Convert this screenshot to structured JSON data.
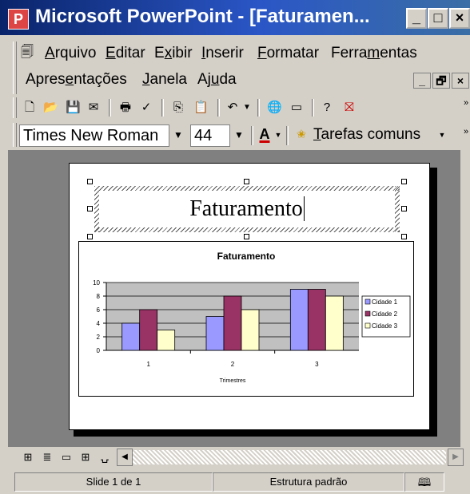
{
  "window": {
    "title": "Microsoft PowerPoint - [Faturamen...",
    "controls": [
      "_",
      "□",
      "×"
    ],
    "doc_controls": [
      "_",
      "🗗",
      "×"
    ]
  },
  "menu": {
    "items": [
      {
        "label": "Arquivo"
      },
      {
        "label": "Editar"
      },
      {
        "label": "Exibir"
      },
      {
        "label": "Inserir"
      },
      {
        "label": "Formatar"
      },
      {
        "label": "Ferramentas"
      },
      {
        "label": "Apresentações"
      },
      {
        "label": "Janela"
      },
      {
        "label": "Ajuda"
      }
    ]
  },
  "formatting": {
    "font_name": "Times New Roman",
    "font_size": "44",
    "tasks_label": "Tarefas comuns"
  },
  "slide": {
    "title": "Faturamento"
  },
  "chart_data": {
    "type": "bar",
    "title": "Faturamento",
    "xlabel": "Trimestres",
    "ylabel": "",
    "categories": [
      "1",
      "2",
      "3"
    ],
    "series": [
      {
        "name": "Cidade 1",
        "values": [
          4,
          5,
          9
        ],
        "color": "#9999ff"
      },
      {
        "name": "Cidade 2",
        "values": [
          6,
          8,
          9
        ],
        "color": "#993366"
      },
      {
        "name": "Cidade 3",
        "values": [
          3,
          6,
          8
        ],
        "color": "#ffffcc"
      }
    ],
    "ylim": [
      0,
      10
    ],
    "yticks": [
      "0",
      "2",
      "4",
      "6",
      "8",
      "10"
    ],
    "grid": true,
    "plot_background": "#c0c0c0",
    "legend": "right"
  },
  "status": {
    "slide": "Slide 1 de 1",
    "design": "Estrutura padrão"
  }
}
